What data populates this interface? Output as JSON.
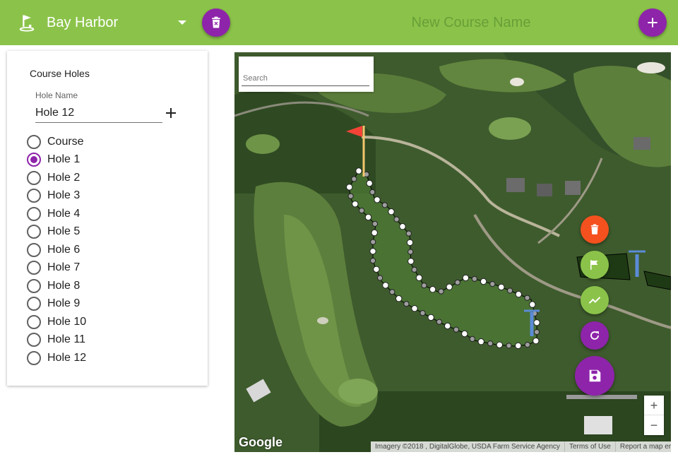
{
  "header": {
    "course_selected": "Bay Harbor",
    "course_name_placeholder": "New Course Name",
    "icons": {
      "logo": "golf-course-icon",
      "delete": "delete-course-icon",
      "add": "add-icon"
    },
    "colors": {
      "bar": "#8bc34a",
      "accent": "#8e24aa"
    }
  },
  "panel": {
    "title": "Course Holes",
    "hole_name_label": "Hole Name",
    "hole_name_value": "Hole 12",
    "holes": [
      {
        "label": "Course",
        "checked": false
      },
      {
        "label": "Hole 1",
        "checked": true
      },
      {
        "label": "Hole 2",
        "checked": false
      },
      {
        "label": "Hole 3",
        "checked": false
      },
      {
        "label": "Hole 4",
        "checked": false
      },
      {
        "label": "Hole 5",
        "checked": false
      },
      {
        "label": "Hole 6",
        "checked": false
      },
      {
        "label": "Hole 7",
        "checked": false
      },
      {
        "label": "Hole 8",
        "checked": false
      },
      {
        "label": "Hole 9",
        "checked": false
      },
      {
        "label": "Hole 10",
        "checked": false
      },
      {
        "label": "Hole 11",
        "checked": false
      },
      {
        "label": "Hole 12",
        "checked": false
      }
    ]
  },
  "map": {
    "search_placeholder": "Search",
    "zoom_in": "+",
    "zoom_out": "−",
    "logo": "Google",
    "attribution": [
      "Imagery ©2018 , DigitalGlobe, USDA Farm Service Agency",
      "Terms of Use",
      "Report a map error"
    ],
    "actions": [
      {
        "name": "delete-shape",
        "icon": "trash-icon",
        "color": "#f4511e"
      },
      {
        "name": "flag",
        "icon": "flag-icon",
        "color": "#8bc34a"
      },
      {
        "name": "polyline",
        "icon": "trending-up-icon",
        "color": "#8bc34a"
      },
      {
        "name": "reset",
        "icon": "refresh-icon",
        "color": "#8e24aa"
      },
      {
        "name": "save",
        "icon": "save-icon",
        "color": "#8e24aa"
      }
    ]
  }
}
